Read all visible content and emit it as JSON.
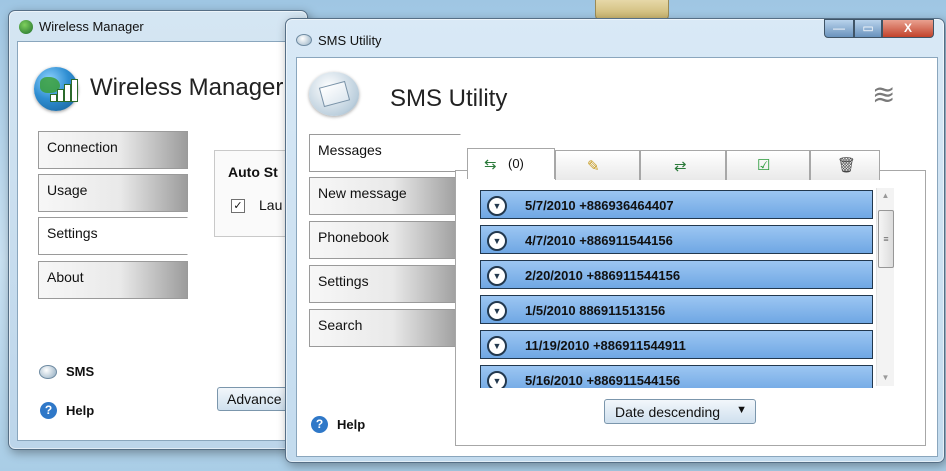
{
  "wireless_manager": {
    "window_title": "Wireless Manager",
    "header_title": "Wireless Manager",
    "tabs": [
      {
        "label": "Connection"
      },
      {
        "label": "Usage"
      },
      {
        "label": "Settings"
      },
      {
        "label": "About"
      }
    ],
    "selected_tab": "Settings",
    "group_label": "Auto St",
    "checkbox_label": "Lau",
    "checkbox_checked": true,
    "advanced_button": "Advance",
    "sms_link": "SMS",
    "help_link": "Help"
  },
  "sms_utility": {
    "window_title": "SMS Utility",
    "header_title": "SMS Utility",
    "titlebar_buttons": {
      "minimize": "—",
      "maximize": "▭",
      "close": "X"
    },
    "side_tabs": [
      {
        "label": "Messages"
      },
      {
        "label": "New message"
      },
      {
        "label": "Phonebook"
      },
      {
        "label": "Settings"
      },
      {
        "label": "Search"
      }
    ],
    "selected_side_tab": "Messages",
    "message_tabs": [
      {
        "icon": "inbox-icon",
        "label": "(0)"
      },
      {
        "icon": "compose-icon",
        "label": ""
      },
      {
        "icon": "sent-icon",
        "label": ""
      },
      {
        "icon": "checked-message-icon",
        "label": ""
      },
      {
        "icon": "trash-icon",
        "label": ""
      }
    ],
    "messages": [
      {
        "text": "5/7/2010 +886936464407"
      },
      {
        "text": "4/7/2010 +886911544156"
      },
      {
        "text": "2/20/2010 +886911544156"
      },
      {
        "text": "1/5/2010 886911513156"
      },
      {
        "text": "11/19/2010 +886911544911"
      },
      {
        "text": "5/16/2010 +886911544156"
      }
    ],
    "sort_selected": "Date descending",
    "help_link": "Help"
  },
  "colors": {
    "row_fill": "#7fb2ea",
    "row_border": "#22384e",
    "close_button": "#c2432b"
  }
}
